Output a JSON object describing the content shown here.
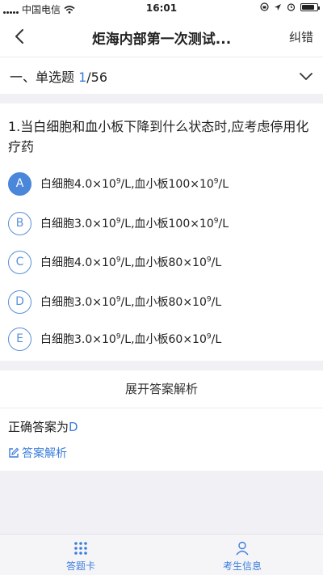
{
  "status_bar": {
    "carrier": "中国电信",
    "time": "16:01",
    "battery_level": 0.85
  },
  "nav": {
    "title": "炬海内部第一次测试...",
    "right_action": "纠错",
    "back_icon": "chevron-left-icon"
  },
  "section": {
    "prefix": "一、单选题 ",
    "current": "1",
    "total": "/56",
    "toggle_icon": "chevron-down-icon"
  },
  "question": {
    "stem": "1.当白细胞和血小板下降到什么状态时,应考虑停用化疗药",
    "selected": "A",
    "options": [
      {
        "letter": "A",
        "wbc": "白细胞4.0×10",
        "wbc_exp": "9",
        "mid": "/L,血小板100×10",
        "plt_exp": "9",
        "tail": "/L"
      },
      {
        "letter": "B",
        "wbc": "白细胞3.0×10",
        "wbc_exp": "9",
        "mid": "/L,血小板100×10",
        "plt_exp": "9",
        "tail": "/L"
      },
      {
        "letter": "C",
        "wbc": "白细胞4.0×10",
        "wbc_exp": "9",
        "mid": "/L,血小板80×10",
        "plt_exp": "9",
        "tail": "/L"
      },
      {
        "letter": "D",
        "wbc": "白细胞3.0×10",
        "wbc_exp": "9",
        "mid": "/L,血小板80×10",
        "plt_exp": "9",
        "tail": "/L"
      },
      {
        "letter": "E",
        "wbc": "白细胞3.0×10",
        "wbc_exp": "9",
        "mid": "/L,血小板60×10",
        "plt_exp": "9",
        "tail": "/L"
      }
    ]
  },
  "analysis": {
    "expand_label": "展开答案解析",
    "correct_prefix": "正确答案为",
    "correct_answer": "D",
    "link_label": "答案解析",
    "link_icon": "edit-icon"
  },
  "tabs": [
    {
      "label": "答题卡",
      "icon": "grid-dots-icon"
    },
    {
      "label": "考生信息",
      "icon": "person-icon"
    }
  ],
  "colors": {
    "accent": "#3b7ddc",
    "background": "#f0f0f5"
  }
}
